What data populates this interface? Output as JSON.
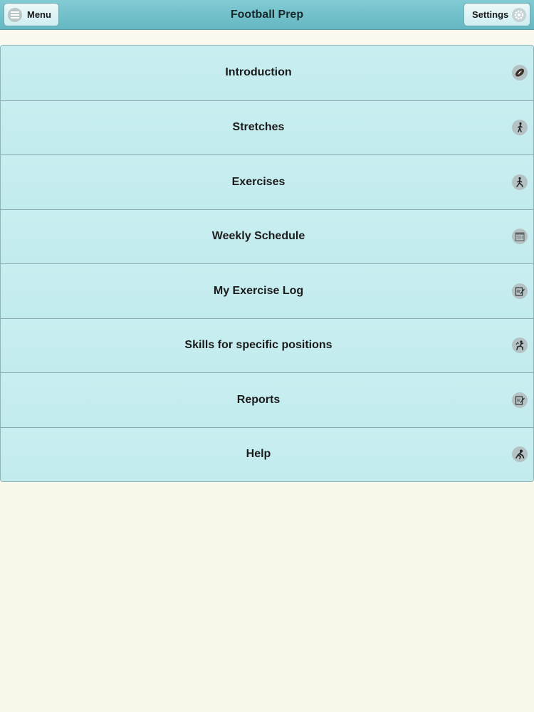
{
  "header": {
    "title": "Football Prep",
    "menu_label": "Menu",
    "settings_label": "Settings"
  },
  "menu_items": [
    {
      "label": "Introduction",
      "icon": "football-icon"
    },
    {
      "label": "Stretches",
      "icon": "stretching-person-icon"
    },
    {
      "label": "Exercises",
      "icon": "exercise-person-icon"
    },
    {
      "label": "Weekly Schedule",
      "icon": "calendar-icon"
    },
    {
      "label": "My Exercise Log",
      "icon": "edit-note-icon"
    },
    {
      "label": "Skills for specific positions",
      "icon": "position-skill-icon"
    },
    {
      "label": "Reports",
      "icon": "report-edit-icon"
    },
    {
      "label": "Help",
      "icon": "help-player-icon"
    }
  ],
  "colors": {
    "header_bg": "#6fbfca",
    "row_bg": "#c4ecef",
    "page_bg": "#f9f8ec"
  }
}
